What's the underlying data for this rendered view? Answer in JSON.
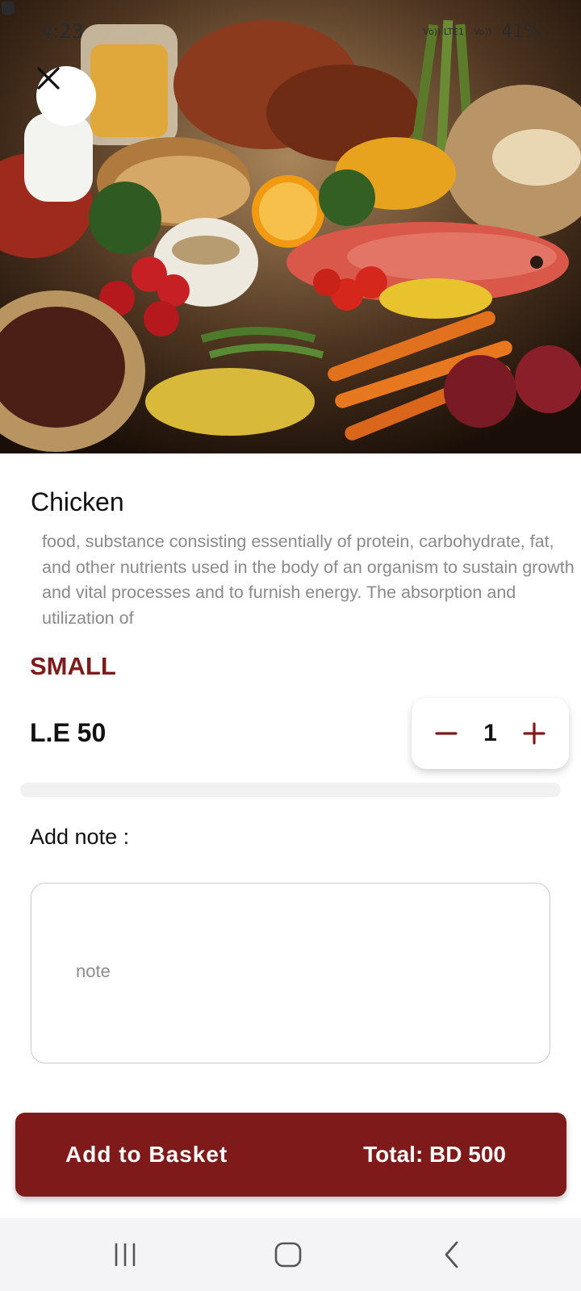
{
  "status_bar": {
    "time": "4:23",
    "battery": "41%",
    "network_1": "Vo)) LTE1",
    "network_2": "Vo))"
  },
  "product": {
    "name": "Chicken",
    "description": "food, substance consisting essentially of protein, carbohydrate, fat, and other nutrients used in the body of an organism to sustain growth and vital processes and to furnish energy. The absorption and utilization of",
    "size": "SMALL",
    "price": "L.E 50",
    "quantity": "1"
  },
  "note": {
    "label": "Add note :",
    "placeholder": "note"
  },
  "basket": {
    "button_label": "Add to Basket",
    "total": "Total: BD 500"
  },
  "icons": {
    "close": "close-icon",
    "minus": "minus-icon",
    "plus": "plus-icon",
    "recents": "recents-icon",
    "home": "home-icon",
    "back": "back-icon"
  },
  "colors": {
    "accent": "#7e1a1a",
    "size_text": "#7d1c1c"
  }
}
